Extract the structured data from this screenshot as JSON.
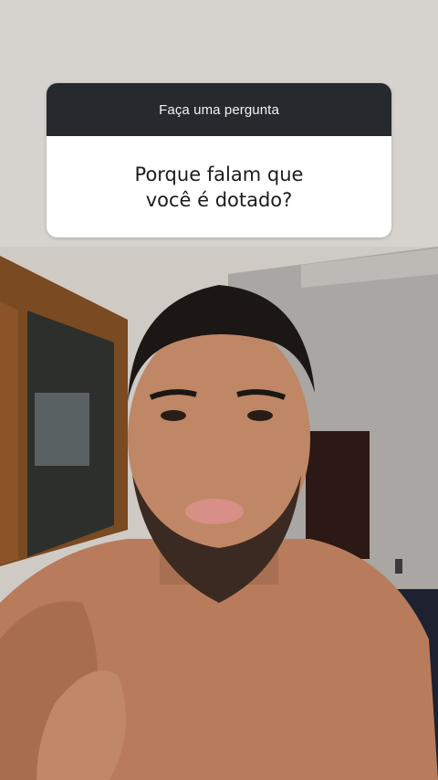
{
  "question_box": {
    "header_text": "Faça uma pergunta",
    "question_text": "Porque falam que você é dotado?"
  },
  "colors": {
    "header_bg": "#262a2f",
    "body_bg": "#ffffff",
    "header_text": "#f2f2f2",
    "question_text": "#1c1c1c"
  },
  "icons": []
}
